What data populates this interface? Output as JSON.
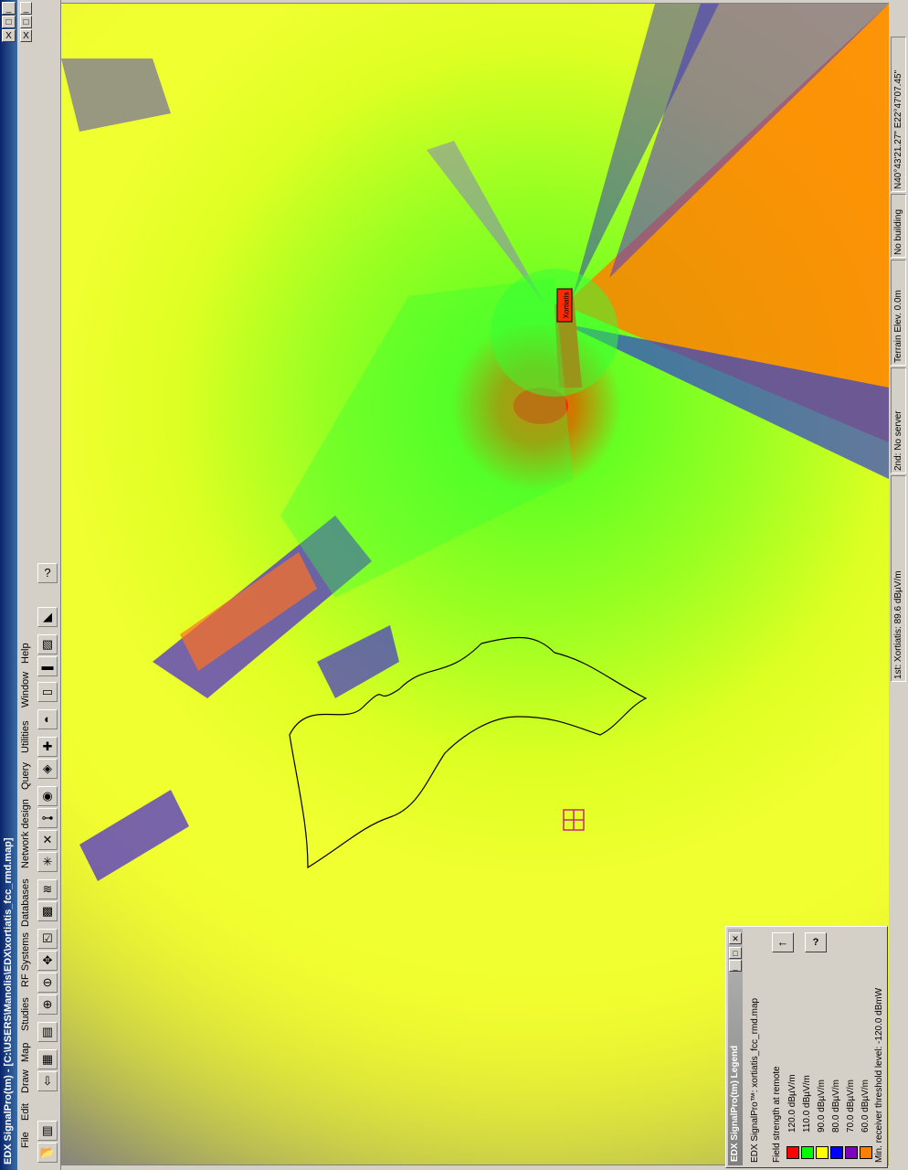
{
  "window": {
    "title": "EDX SignalPro(tm) - [C:\\USERS\\Manolis\\EDX\\xortiatis_fcc_rmd.map]",
    "buttons": [
      "_",
      "□",
      "X",
      "_",
      "□",
      "X"
    ]
  },
  "menu": [
    "File",
    "Edit",
    "Draw",
    "Map",
    "Studies",
    "RF Systems",
    "Databases",
    "Network design",
    "Query",
    "Utilities",
    "Window",
    "Help"
  ],
  "toolbar": {
    "icons": [
      "open-file-icon",
      "save-icon",
      "print-icon",
      "layers-icon",
      "copy-icon",
      "zoom-in-icon",
      "zoom-out-icon",
      "pan-icon",
      "select-icon",
      "grid-icon",
      "tower-icon",
      "antenna-icon",
      "ruler-icon",
      "area-study-icon",
      "profile-icon",
      "point-icon",
      "network-icon",
      "link-icon",
      "report-icon",
      "chart-icon",
      "legend-icon",
      "help-icon"
    ]
  },
  "map": {
    "site_label": "Xortiatis",
    "colors": {
      "background": "#dfff3a",
      "strong": "#ff2a00",
      "green": "#33ff33",
      "orange": "#ff8000",
      "purple": "#8030c0",
      "blue": "#2020e0",
      "gray": "#808080"
    }
  },
  "legend": {
    "window_title": "EDX SignalPro(tm) Legend",
    "file_line": "EDX SignalPro™: xortiatis_fcc_rmd.map",
    "heading": "Field strength at remote",
    "arrow": "←",
    "help": "?",
    "items": [
      {
        "label": "120.0 dBµV/m",
        "color": "#ff0000"
      },
      {
        "label": "110.0 dBµV/m",
        "color": "#00ff00"
      },
      {
        "label": "90.0 dBµV/m",
        "color": "#ffff00"
      },
      {
        "label": "80.0 dBµV/m",
        "color": "#0000ff"
      },
      {
        "label": "70.0 dBµV/m",
        "color": "#8000c0"
      },
      {
        "label": "60.0 dBµV/m",
        "color": "#ff8000"
      }
    ],
    "threshold": "Min. receiver threshold level: -120.0 dBmW"
  },
  "status": {
    "first": "1st: Xortiatis: 89.6 dBµV/m",
    "second": "2nd: No server",
    "terrain": "Terrain Elev. 0.0m",
    "building": "No building",
    "coords": "N40°43'21.27\" E22°47'07.45\""
  }
}
